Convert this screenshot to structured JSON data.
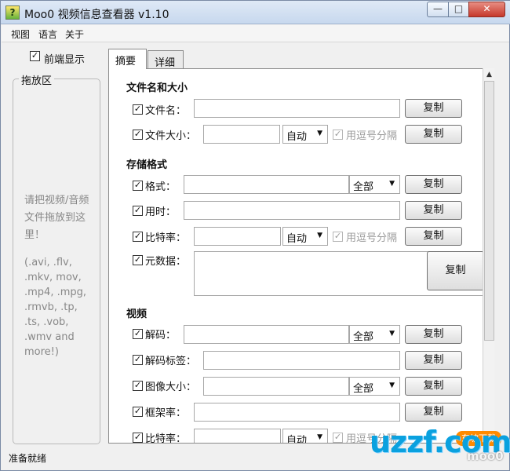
{
  "window": {
    "title": "Moo0 视频信息查看器 v1.10",
    "app_icon": "?",
    "controls": {
      "minimize": "—",
      "maximize": "□",
      "close": "✕"
    }
  },
  "menu": [
    "视图",
    "语言",
    "关于"
  ],
  "left": {
    "front_checked": "✓",
    "front_label": "前端显示",
    "drop_title": "拖放区",
    "drop_text": "请把视频/音频文件拖放到这里！",
    "formats": "(.avi, .flv, .mkv, mov, .mp4, .mpg, .rmvb, .tp, .ts, .vob, .wmv and more!)"
  },
  "tabs": [
    "摘要",
    "详细"
  ],
  "sections": {
    "file": "文件名和大小",
    "storage": "存储格式",
    "video": "视频"
  },
  "fields": {
    "filename": "文件名：",
    "filesize": "文件大小：",
    "format": "格式：",
    "duration": "用时：",
    "bitrate": "比特率：",
    "metadata": "元数据：",
    "codec": "解码：",
    "codec_tag": "解码标签：",
    "image_size": "图像大小：",
    "frame_rate": "框架率：",
    "bitrate2": "比特率："
  },
  "options": {
    "auto": "自动",
    "all": "全部",
    "comma": "用逗号分隔"
  },
  "check_mark": "✓",
  "copy_label": "复制",
  "status": "准备就绪",
  "watermark": {
    "main": "uzzf.com",
    "badge": "东坡下载",
    "moo": "moo0"
  }
}
